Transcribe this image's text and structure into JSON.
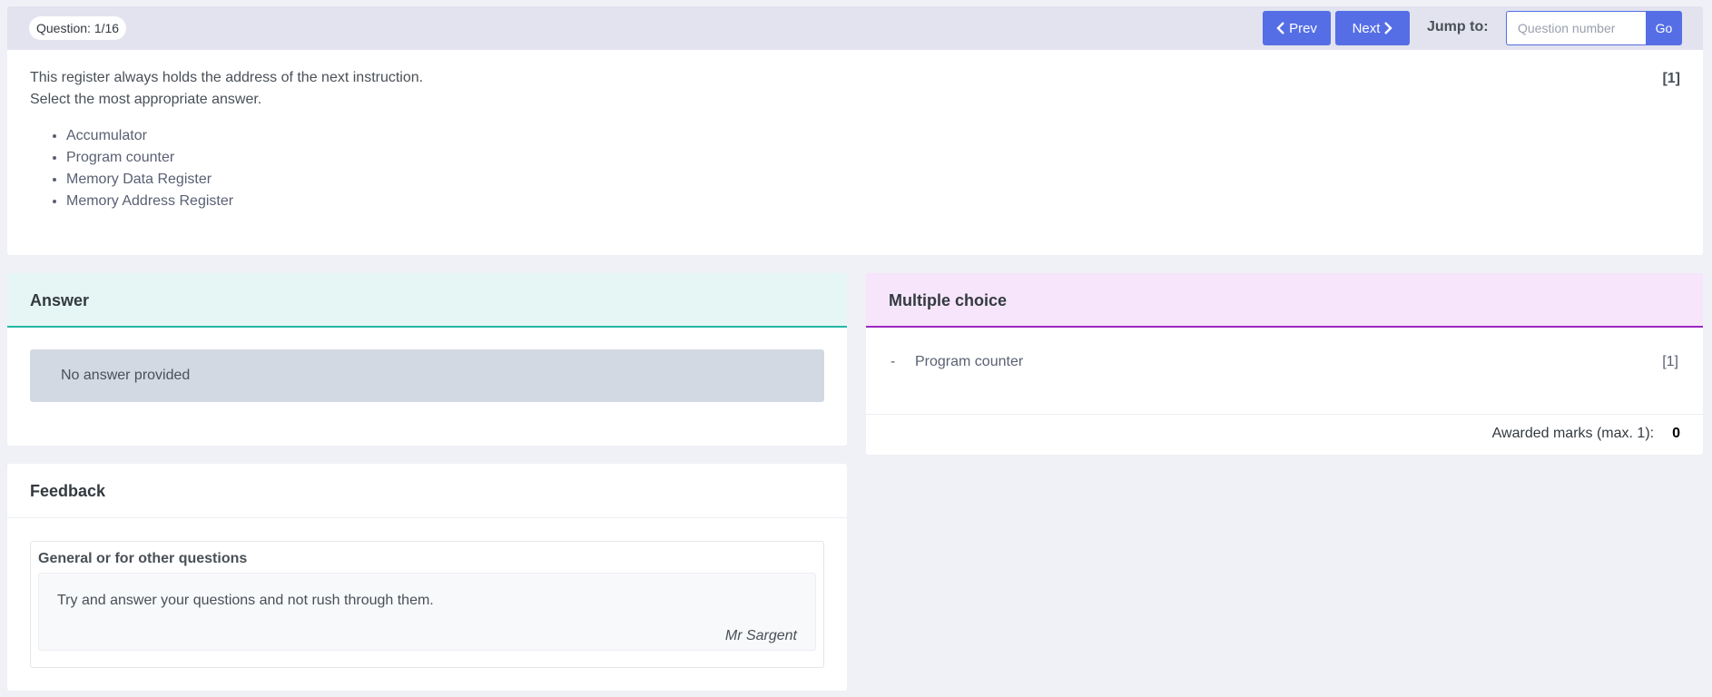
{
  "header": {
    "question_badge": "Question: 1/16",
    "prev_label": "Prev",
    "next_label": "Next",
    "jump_label": "Jump to:",
    "jump_placeholder": "Question number",
    "go_label": "Go",
    "accent": "#556ee6"
  },
  "question": {
    "line1": "This register always holds the address of the next instruction.",
    "line2": "Select the most appropriate answer.",
    "marks": "[1]",
    "options": [
      "Accumulator",
      "Program counter",
      "Memory Data Register",
      "Memory Address Register"
    ]
  },
  "answer": {
    "title": "Answer",
    "value": "No answer provided",
    "accent": "#26b6a6"
  },
  "multiple_choice": {
    "title": "Multiple choice",
    "bullet": "-",
    "choice": "Program counter",
    "choice_marks": "[1]",
    "awarded_label": "Awarded marks (max. 1):",
    "awarded_value": "0",
    "accent": "#9b27c2"
  },
  "feedback": {
    "title": "Feedback",
    "section_title": "General or for other questions",
    "text": "Try and answer your questions and not rush through them.",
    "author": "Mr Sargent"
  }
}
